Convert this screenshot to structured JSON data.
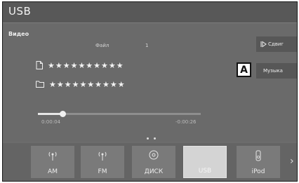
{
  "header": {
    "title": "USB"
  },
  "main": {
    "source_label": "Видео",
    "file_label": "Файл",
    "file_number": "1",
    "track_title": "★★★★★★★★★★",
    "folder_name": "★★★★★★★★★★",
    "progress": {
      "fraction": 0.15,
      "elapsed": "0:00:04",
      "remaining": "-0:00:26"
    }
  },
  "side_buttons": {
    "sources_label": "Сдвиг",
    "music_label": "Музыка"
  },
  "callout": {
    "label": "A"
  },
  "bottom_bar": {
    "tiles": [
      {
        "label": "AM",
        "icon": "radio-antenna-icon"
      },
      {
        "label": "FM",
        "icon": "radio-antenna-icon"
      },
      {
        "label": "ДИСК",
        "icon": "disc-icon"
      },
      {
        "label": "USB",
        "icon": "usb-icon",
        "selected": true
      },
      {
        "label": "iPod",
        "icon": "ipod-icon"
      }
    ],
    "next_icon": "chevron-right-icon",
    "page_count": 2
  }
}
